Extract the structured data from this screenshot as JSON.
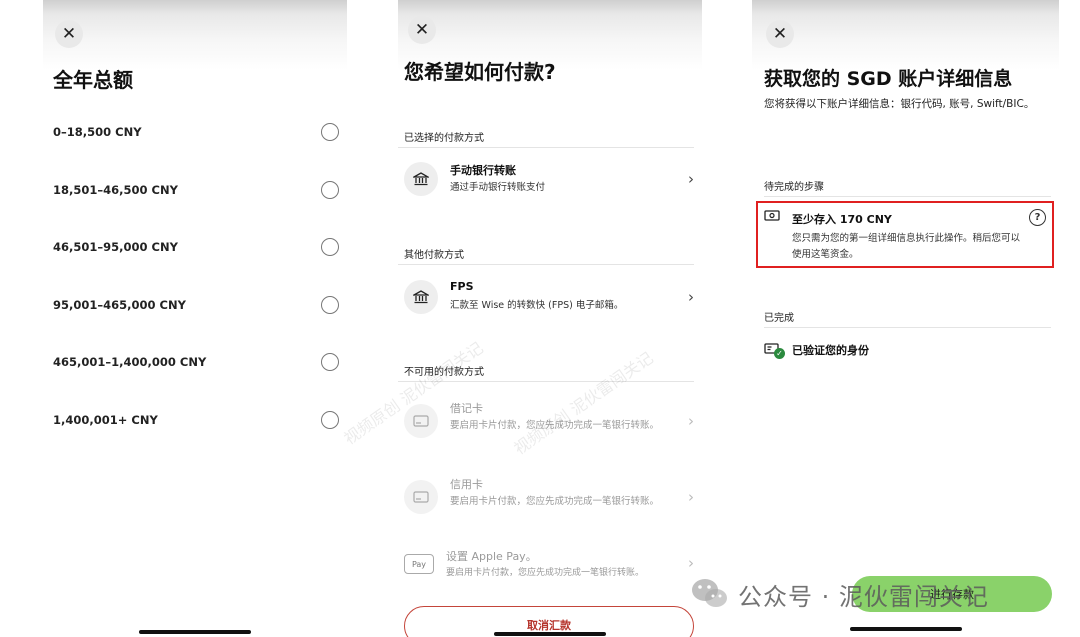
{
  "panel1": {
    "title": "全年总额",
    "options": [
      "0–18,500 CNY",
      "18,501–46,500 CNY",
      "46,501–95,000 CNY",
      "95,001–465,000 CNY",
      "465,001–1,400,000 CNY",
      "1,400,001+ CNY"
    ]
  },
  "panel2": {
    "title": "您希望如何付款?",
    "selected_label": "已选择的付款方式",
    "selected_method": {
      "name": "手动银行转账",
      "desc": "通过手动银行转账支付",
      "icon": "bank-icon"
    },
    "other_label": "其他付款方式",
    "other_method": {
      "name": "FPS",
      "desc": "汇款至 Wise 的转数快 (FPS) 电子邮箱。",
      "icon": "bank-icon"
    },
    "unavailable_label": "不可用的付款方式",
    "unavailable_methods": [
      {
        "name": "借记卡",
        "desc": "要启用卡片付款，您应先成功完成一笔银行转账。",
        "icon": "card-icon"
      },
      {
        "name": "信用卡",
        "desc": "要启用卡片付款，您应先成功完成一笔银行转账。",
        "icon": "card-icon"
      },
      {
        "name": "设置 Apple Pay。",
        "desc": "要启用卡片付款，您应先成功完成一笔银行转账。",
        "icon": "apple-pay-icon",
        "badge": "Pay"
      }
    ],
    "cancel_label": "取消汇款"
  },
  "panel3": {
    "title": "获取您的 SGD 账户详细信息",
    "subtitle": "您将获得以下账户详细信息：银行代码, 账号, Swift/BIC。",
    "pending_label": "待完成的步骤",
    "pending_step": {
      "title": "至少存入 170 CNY",
      "desc": "您只需为您的第一组详细信息执行此操作。稍后您可以使用这笔资金。"
    },
    "completed_label": "已完成",
    "completed_step": {
      "title": "已验证您的身份"
    },
    "deposit_label": "进行存款"
  },
  "watermark": {
    "text": "公众号 · 泥伙雷闯关记",
    "diagonal": "视频原创 泥伙雷闯关记"
  },
  "colors": {
    "highlight_border": "#e02020",
    "cancel": "#b5332b",
    "deposit": "#8ad26a"
  }
}
